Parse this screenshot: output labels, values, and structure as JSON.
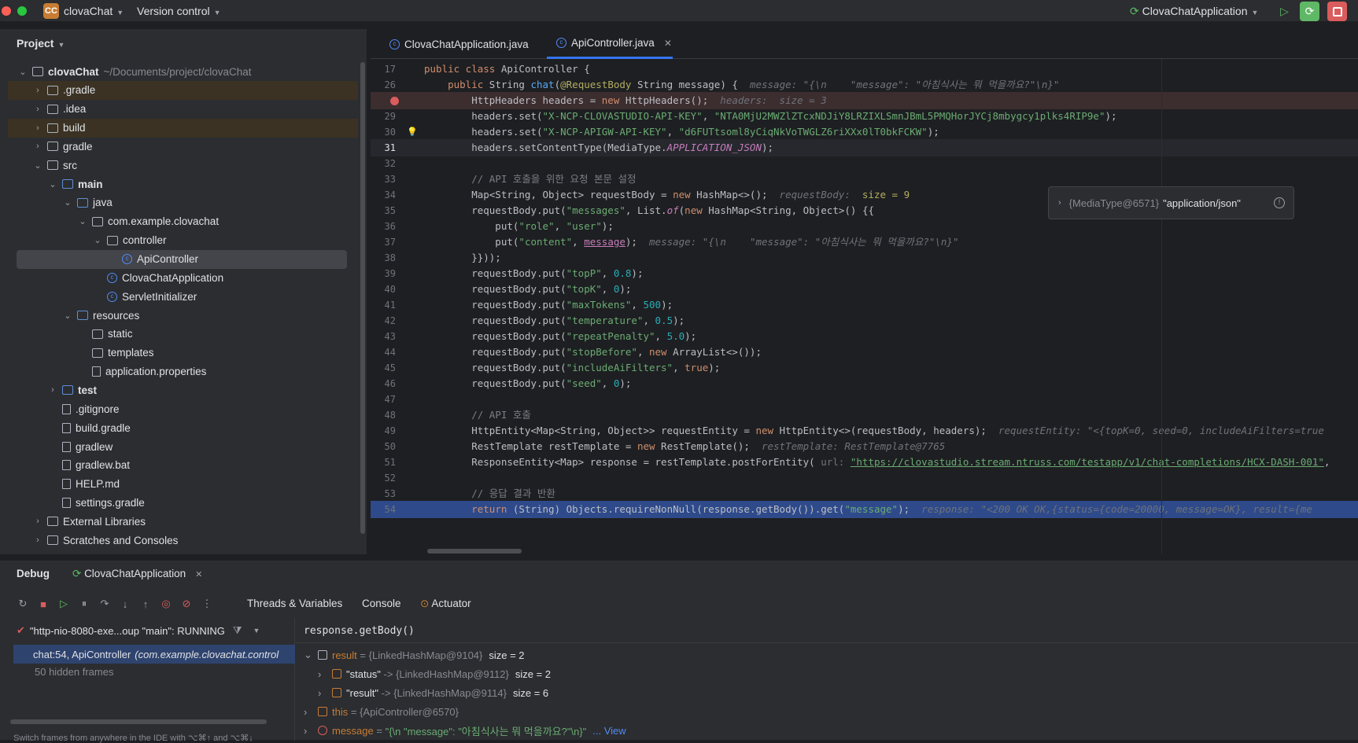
{
  "topbar": {
    "project_badge": "CC",
    "project_name": "clovaChat",
    "vcs": "Version control",
    "run_config": "ClovaChatApplication"
  },
  "project_panel": {
    "title": "Project",
    "items": [
      {
        "label": "clovaChat",
        "hint": "~/Documents/project/clovaChat",
        "depth": 0,
        "open": true,
        "bold": true,
        "icon": "module-folder-icon"
      },
      {
        "label": ".gradle",
        "depth": 1,
        "icon": "folder-icon",
        "hl": true
      },
      {
        "label": ".idea",
        "depth": 1,
        "icon": "folder-icon"
      },
      {
        "label": "build",
        "depth": 1,
        "icon": "folder-icon",
        "hl": true
      },
      {
        "label": "gradle",
        "depth": 1,
        "icon": "folder-icon"
      },
      {
        "label": "src",
        "depth": 1,
        "open": true,
        "icon": "folder-icon"
      },
      {
        "label": "main",
        "depth": 2,
        "open": true,
        "bold": true,
        "icon": "source-folder-icon"
      },
      {
        "label": "java",
        "depth": 3,
        "open": true,
        "icon": "java-folder-icon"
      },
      {
        "label": "com.example.clovachat",
        "depth": 4,
        "open": true,
        "icon": "package-icon"
      },
      {
        "label": "controller",
        "depth": 5,
        "open": true,
        "icon": "package-icon"
      },
      {
        "label": "ApiController",
        "depth": 6,
        "leaf": true,
        "icon": "class-icon",
        "selected": true
      },
      {
        "label": "ClovaChatApplication",
        "depth": 5,
        "leaf": true,
        "icon": "spring-class-icon"
      },
      {
        "label": "ServletInitializer",
        "depth": 5,
        "leaf": true,
        "icon": "class-icon"
      },
      {
        "label": "resources",
        "depth": 3,
        "open": true,
        "icon": "resources-folder-icon"
      },
      {
        "label": "static",
        "depth": 4,
        "leaf": true,
        "icon": "folder-icon"
      },
      {
        "label": "templates",
        "depth": 4,
        "leaf": true,
        "icon": "folder-icon"
      },
      {
        "label": "application.properties",
        "depth": 4,
        "leaf": true,
        "icon": "properties-file-icon"
      },
      {
        "label": "test",
        "depth": 2,
        "bold": true,
        "icon": "test-folder-icon"
      },
      {
        "label": ".gitignore",
        "depth": 2,
        "leaf": true,
        "icon": "ignore-file-icon"
      },
      {
        "label": "build.gradle",
        "depth": 2,
        "leaf": true,
        "icon": "gradle-file-icon"
      },
      {
        "label": "gradlew",
        "depth": 2,
        "leaf": true,
        "icon": "terminal-file-icon"
      },
      {
        "label": "gradlew.bat",
        "depth": 2,
        "leaf": true,
        "icon": "text-file-icon"
      },
      {
        "label": "HELP.md",
        "depth": 2,
        "leaf": true,
        "icon": "markdown-file-icon"
      },
      {
        "label": "settings.gradle",
        "depth": 2,
        "leaf": true,
        "icon": "gradle-file-icon"
      },
      {
        "label": "External Libraries",
        "depth": 1,
        "icon": "libraries-icon"
      },
      {
        "label": "Scratches and Consoles",
        "depth": 1,
        "icon": "scratches-icon"
      }
    ]
  },
  "editor": {
    "tabs": [
      {
        "label": "ClovaChatApplication.java",
        "active": false
      },
      {
        "label": "ApiController.java",
        "active": true
      }
    ],
    "popup": {
      "ref": "{MediaType@6571}",
      "value": "\"application/json\""
    },
    "lines": [
      {
        "n": "17",
        "t": "<span class='kw'>public class</span> ApiController {"
      },
      {
        "n": "26",
        "t": "    <span class='kw'>public</span> String <span class='fn'>chat</span>(<span class='an'>@RequestBody</span> String message) {  <span class='hint'>message: \"{\\n    \"message\": \"아침식사는 뭐 먹을까요?\"\\n}\"</span>"
      },
      {
        "n": "",
        "t": "        HttpHeaders headers = <span class='kw'>new</span> HttpHeaders();  <span class='hint'>headers:  size = 3</span>",
        "bp": true
      },
      {
        "n": "29",
        "t": "        headers.set(<span class='str'>\"X-NCP-CLOVASTUDIO-API-KEY\"</span>, <span class='str'>\"NTA0MjU2MWZlZTcxNDJiY8LRZIXLSmnJBmL5PMQHorJYCj8mbygcy1plks4RIP9e\"</span>);"
      },
      {
        "n": "30",
        "t": "        headers.set(<span class='str'>\"X-NCP-APIGW-API-KEY\"</span>, <span class='str'>\"d6FUTtsoml8yCiqNkVoTWGLZ6riXXx0lT0bkFCKW\"</span>);",
        "bulb": true
      },
      {
        "n": "31",
        "t": "        headers.setContentType(MediaType.<span class='con'>APPLICATION_JSON</span>);",
        "cur": true
      },
      {
        "n": "32",
        "t": ""
      },
      {
        "n": "33",
        "t": "        <span class='cm'>// API 호출을 위한 요청 본문 설정</span>"
      },
      {
        "n": "34",
        "t": "        Map&lt;String, Object&gt; requestBody = <span class='kw'>new</span> HashMap&lt;&gt;();  <span class='hint'>requestBody:  </span><span class='an'>size = 9</span>"
      },
      {
        "n": "35",
        "t": "        requestBody.put(<span class='str'>\"messages\"</span>, List.<span class='con'>of</span>(<span class='kw'>new</span> HashMap&lt;String, Object&gt;() {{"
      },
      {
        "n": "36",
        "t": "            put(<span class='str'>\"role\"</span>, <span class='str'>\"user\"</span>);"
      },
      {
        "n": "37",
        "t": "            put(<span class='str'>\"content\"</span>, <span class='con' style='font-style:normal;text-decoration:underline'>message</span>);  <span class='hint'>message: \"{\\n    \"message\": \"아침식사는 뭐 먹을까요?\"\\n}\"</span>"
      },
      {
        "n": "38",
        "t": "        }}));"
      },
      {
        "n": "39",
        "t": "        requestBody.put(<span class='str'>\"topP\"</span>, <span class='num'>0.8</span>);"
      },
      {
        "n": "40",
        "t": "        requestBody.put(<span class='str'>\"topK\"</span>, <span class='num'>0</span>);"
      },
      {
        "n": "41",
        "t": "        requestBody.put(<span class='str'>\"maxTokens\"</span>, <span class='num'>500</span>);"
      },
      {
        "n": "42",
        "t": "        requestBody.put(<span class='str'>\"temperature\"</span>, <span class='num'>0.5</span>);"
      },
      {
        "n": "43",
        "t": "        requestBody.put(<span class='str'>\"repeatPenalty\"</span>, <span class='num'>5.0</span>);"
      },
      {
        "n": "44",
        "t": "        requestBody.put(<span class='str'>\"stopBefore\"</span>, <span class='kw'>new</span> ArrayList&lt;&gt;());"
      },
      {
        "n": "45",
        "t": "        requestBody.put(<span class='str'>\"includeAiFilters\"</span>, <span class='kw'>true</span>);"
      },
      {
        "n": "46",
        "t": "        requestBody.put(<span class='str'>\"seed\"</span>, <span class='num'>0</span>);"
      },
      {
        "n": "47",
        "t": ""
      },
      {
        "n": "48",
        "t": "        <span class='cm'>// API 호출</span>"
      },
      {
        "n": "49",
        "t": "        HttpEntity&lt;Map&lt;String, Object&gt;&gt; requestEntity = <span class='kw'>new</span> HttpEntity&lt;&gt;(requestBody, headers);  <span class='hint'>requestEntity: \"&lt;{topK=0, seed=0, includeAiFilters=true</span>"
      },
      {
        "n": "50",
        "t": "        RestTemplate restTemplate = <span class='kw'>new</span> RestTemplate();  <span class='hint'>restTemplate: RestTemplate@7765</span>"
      },
      {
        "n": "51",
        "t": "        ResponseEntity&lt;Map&gt; response = restTemplate.postForEntity( <span class='hint' style='font-style:normal'>url:</span> <span class='str' style='text-decoration:underline'>\"https://clovastudio.stream.ntruss.com/testapp/v1/chat-completions/HCX-DASH-001\"</span>,"
      },
      {
        "n": "52",
        "t": ""
      },
      {
        "n": "53",
        "t": "        <span class='cm'>// 응답 결과 반환</span>"
      },
      {
        "n": "54",
        "t": "        <span class='kw'>return</span> (String) Objects.requireNonNull(response.getBody()).get(<span class='str'>\"message\"</span>);  <span class='hint'>response: \"&lt;200 OK OK,{status={code=20000, message=OK}, result={me</span>",
        "exec": true
      }
    ]
  },
  "debug": {
    "title": "Debug",
    "session": "ClovaChatApplication",
    "tabs": [
      "Threads & Variables",
      "Console",
      "Actuator"
    ],
    "thread": "\"http-nio-8080-exe...oup \"main\": RUNNING",
    "frame_method": "chat:54, ApiController",
    "frame_class": "(com.example.clovachat.control",
    "hidden_frames": "50 hidden frames",
    "hint_text": "Switch frames from anywhere in the IDE with ⌥⌘↑ and ⌥⌘↓",
    "expression": "response.getBody()",
    "vars": [
      {
        "name": "result",
        "eq": " = ",
        "ref": "{LinkedHashMap@9104}",
        "size": "size = 2",
        "depth": 0,
        "open": true,
        "icon": "table"
      },
      {
        "name": "\"status\"",
        "eq": " -> ",
        "ref": "{LinkedHashMap@9112}",
        "size": "size = 2",
        "depth": 1,
        "icon": "entry"
      },
      {
        "name": "\"result\"",
        "eq": " -> ",
        "ref": "{LinkedHashMap@9114}",
        "size": "size = 6",
        "depth": 1,
        "icon": "entry"
      },
      {
        "name": "this",
        "eq": " = ",
        "ref": "{ApiController@6570}",
        "size": "",
        "depth": 0,
        "icon": "entry"
      },
      {
        "name": "message",
        "eq": " = ",
        "ref": "\"{\\n   \"message\": \"아침식사는 뭐 먹을까요?\"\\n}\"",
        "size": "... View",
        "depth": 0,
        "icon": "param"
      }
    ]
  }
}
